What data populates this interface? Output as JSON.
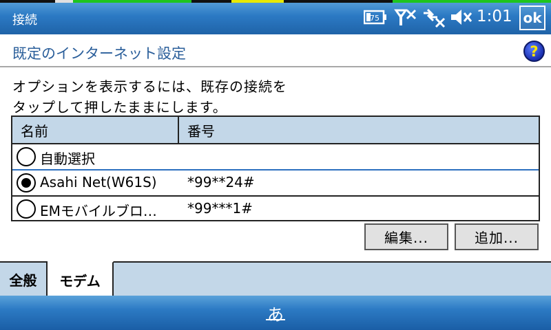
{
  "titlebar": {
    "title": "接続",
    "clock": "1:01",
    "ok_label": "ok",
    "battery_icon_text": "75",
    "icons": [
      "battery-icon",
      "signal-off-icon",
      "connection-off-icon",
      "speaker-muted-icon"
    ]
  },
  "page": {
    "title": "既定のインターネット設定",
    "help_label": "?",
    "instruction_line1": "オプションを表示するには、既存の接続を",
    "instruction_line2": "タップして押したままにします。"
  },
  "list": {
    "headers": {
      "name": "名前",
      "number": "番号"
    },
    "rows": [
      {
        "name": "自動選択",
        "number": "",
        "selected": false
      },
      {
        "name": "Asahi Net(W61S)",
        "number": "*99**24#",
        "selected": true
      },
      {
        "name": "EMモバイルブロ…",
        "number": "*99***1#",
        "selected": false
      }
    ]
  },
  "buttons": {
    "edit": "編集...",
    "add": "追加..."
  },
  "tabs": {
    "general": "全般",
    "modem": "モデム",
    "active": "modem"
  },
  "bottombar": {
    "ime_label": "あ"
  },
  "colors": {
    "titlebar": "#2c7ac4",
    "title_text": "#2a5e9a",
    "list_header_bg": "#c3d7e8",
    "row_separator": "#2b6fbf",
    "help_icon": "#1a2fb0"
  }
}
